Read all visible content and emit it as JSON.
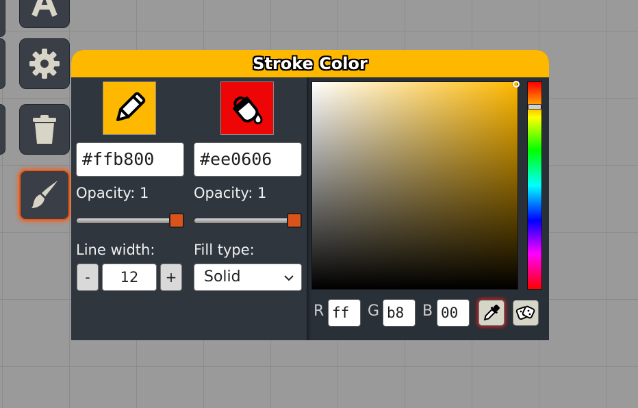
{
  "toolbar": {
    "icons": [
      "text-icon",
      "gear-icon",
      "trash-icon",
      "paintbrush-icon"
    ],
    "active": "paintbrush-icon",
    "accent_color": "#ee5a12"
  },
  "panel": {
    "title": "Stroke Color",
    "header_color": "#ffb800",
    "stroke": {
      "icon": "pencil-icon",
      "swatch_color": "#ffb800",
      "hex": "#ffb800",
      "opacity_label": "Opacity: 1",
      "opacity": 1
    },
    "fill": {
      "icon": "paint-bucket-icon",
      "swatch_color": "#ee0606",
      "hex": "#ee0606",
      "opacity_label": "Opacity: 1",
      "opacity": 1
    },
    "line_width": {
      "label": "Line width:",
      "decrement": "-",
      "value": "12",
      "increment": "+"
    },
    "fill_type": {
      "label": "Fill type:",
      "selected": "Solid"
    },
    "picker": {
      "hue_color": "#ffb800",
      "r_label": "R",
      "r_value": "ff",
      "g_label": "G",
      "g_value": "b8",
      "b_label": "B",
      "b_value": "00",
      "eyedropper_icon": "eyedropper-icon",
      "random_icon": "dice-icon"
    }
  }
}
